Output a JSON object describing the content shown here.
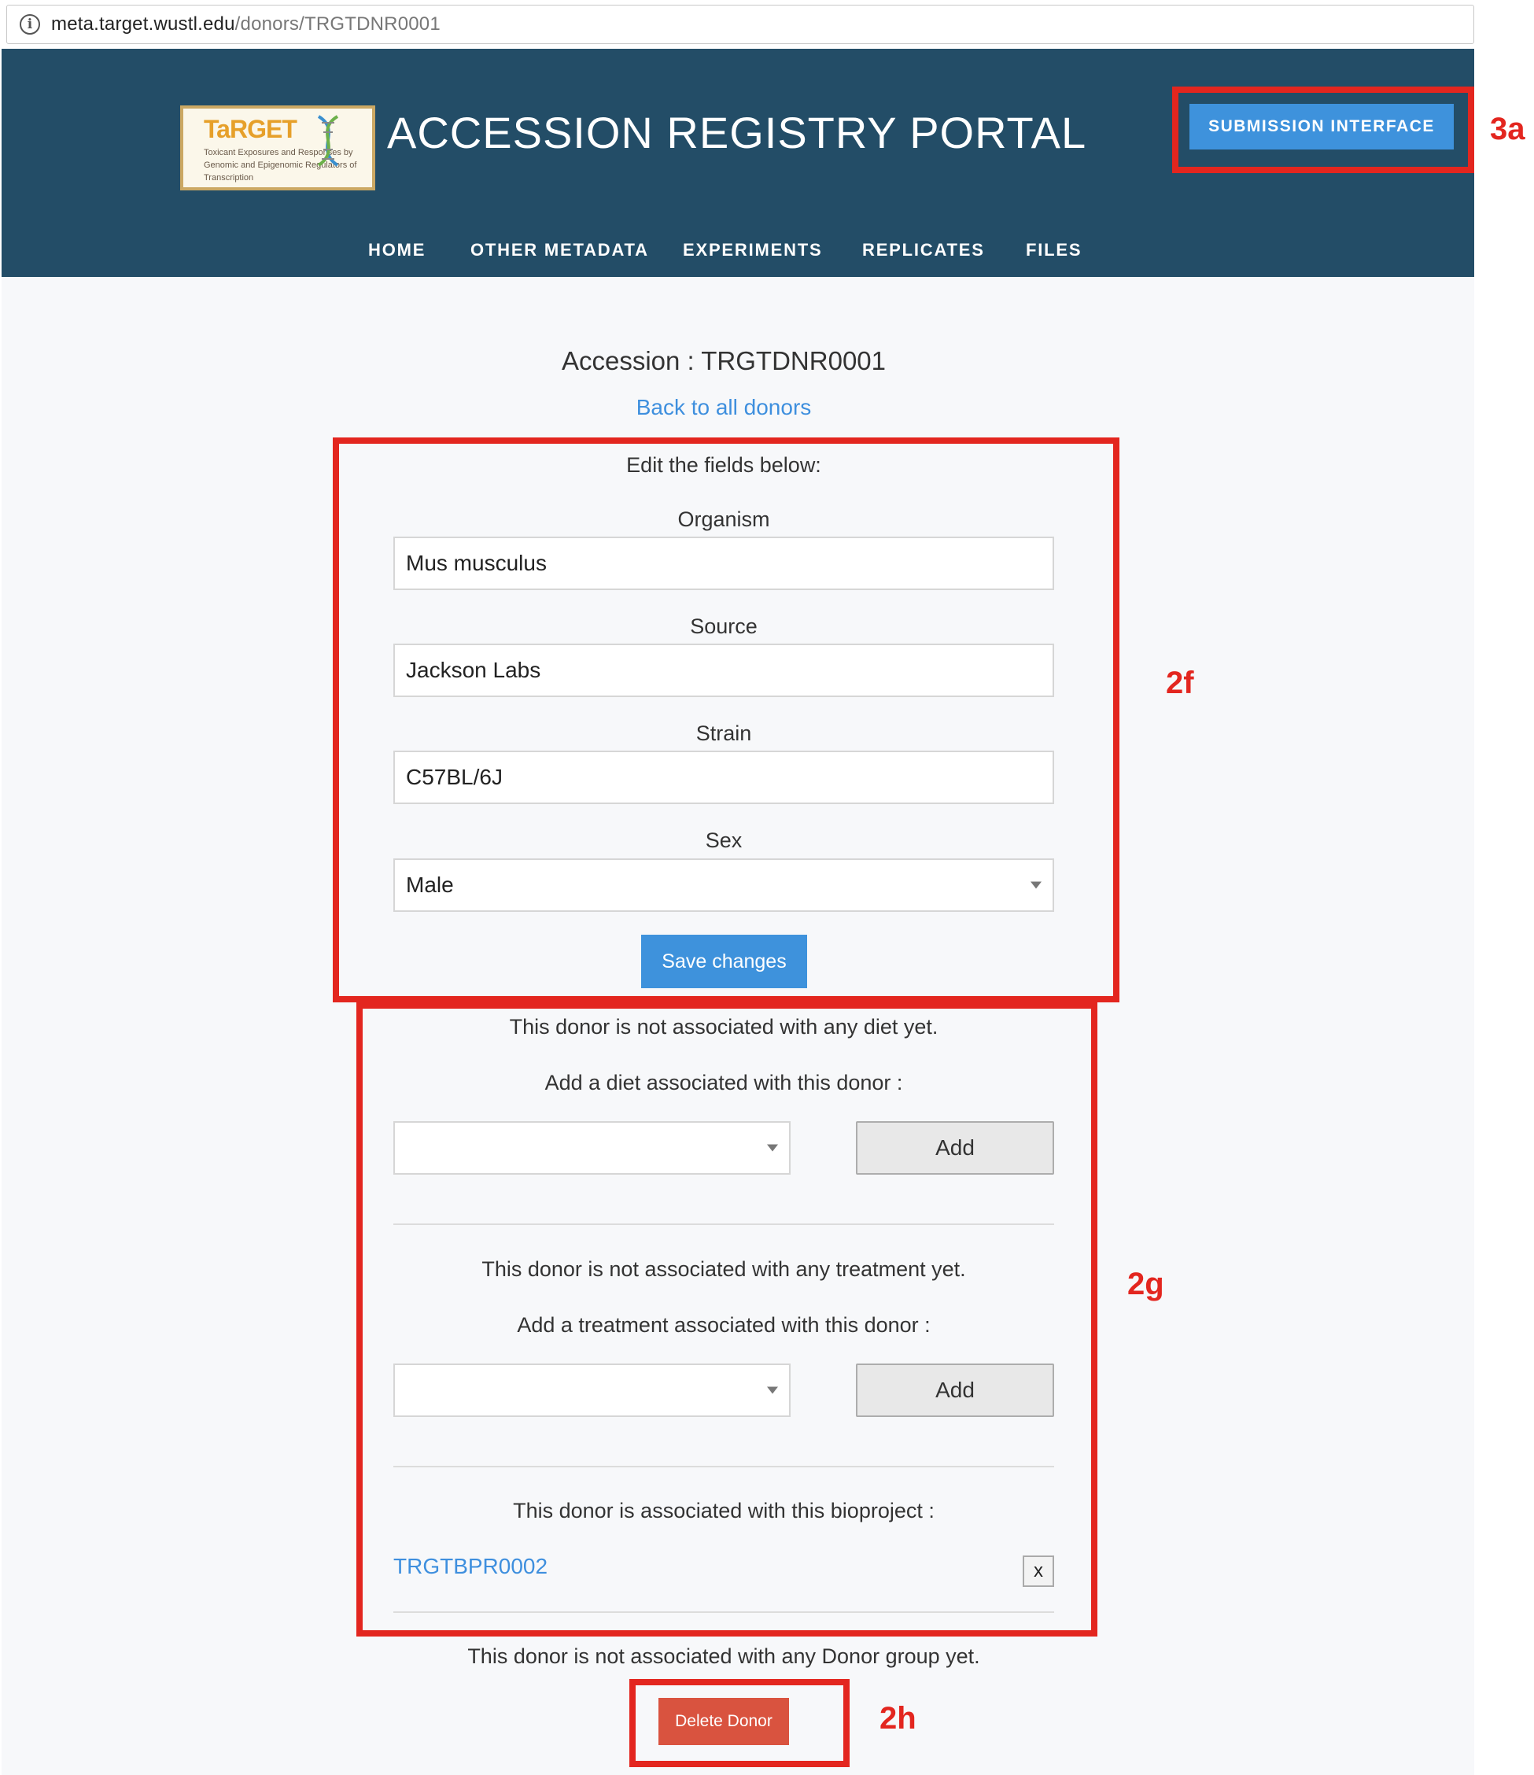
{
  "browser": {
    "url_host": "meta.target.wustl.edu",
    "url_path": "/donors/TRGTDNR0001"
  },
  "header": {
    "logo_word": "TaRGET",
    "logo_subtitle": "Toxicant Exposures and Responses by Genomic and Epigenomic Regulators of Transcription",
    "title": "ACCESSION REGISTRY PORTAL",
    "submission_button": "SUBMISSION INTERFACE"
  },
  "nav": {
    "items": [
      "HOME",
      "OTHER METADATA",
      "EXPERIMENTS",
      "REPLICATES",
      "FILES"
    ]
  },
  "donor": {
    "accession_heading": "Accession : TRGTDNR0001",
    "back_link": "Back to all donors",
    "edit_prompt": "Edit the fields below:",
    "fields": {
      "organism": {
        "label": "Organism",
        "value": "Mus musculus"
      },
      "source": {
        "label": "Source",
        "value": "Jackson Labs"
      },
      "strain": {
        "label": "Strain",
        "value": "C57BL/6J"
      },
      "sex": {
        "label": "Sex",
        "value": "Male"
      }
    },
    "save_button": "Save changes"
  },
  "associations": {
    "diet_status": "This donor is not associated with any diet yet.",
    "diet_prompt": "Add a diet associated with this donor :",
    "diet_add_button": "Add",
    "treatment_status": "This donor is not associated with any treatment yet.",
    "treatment_prompt": "Add a treatment associated with this donor :",
    "treatment_add_button": "Add",
    "bioproject_status": "This donor is associated with this bioproject :",
    "bioproject_id": "TRGTBPR0002",
    "bioproject_remove": "x",
    "donor_group_status": "This donor is not associated with any Donor group yet.",
    "delete_button": "Delete Donor"
  },
  "annotations": {
    "submission_box": "3a",
    "edit_box": "2f",
    "association_box": "2g",
    "delete_box": "2h",
    "color": "#e3261f"
  },
  "colors": {
    "header_bg": "#234d67",
    "primary_button": "#3e92dc",
    "link": "#3e8fde",
    "danger_button": "#d9533f"
  }
}
